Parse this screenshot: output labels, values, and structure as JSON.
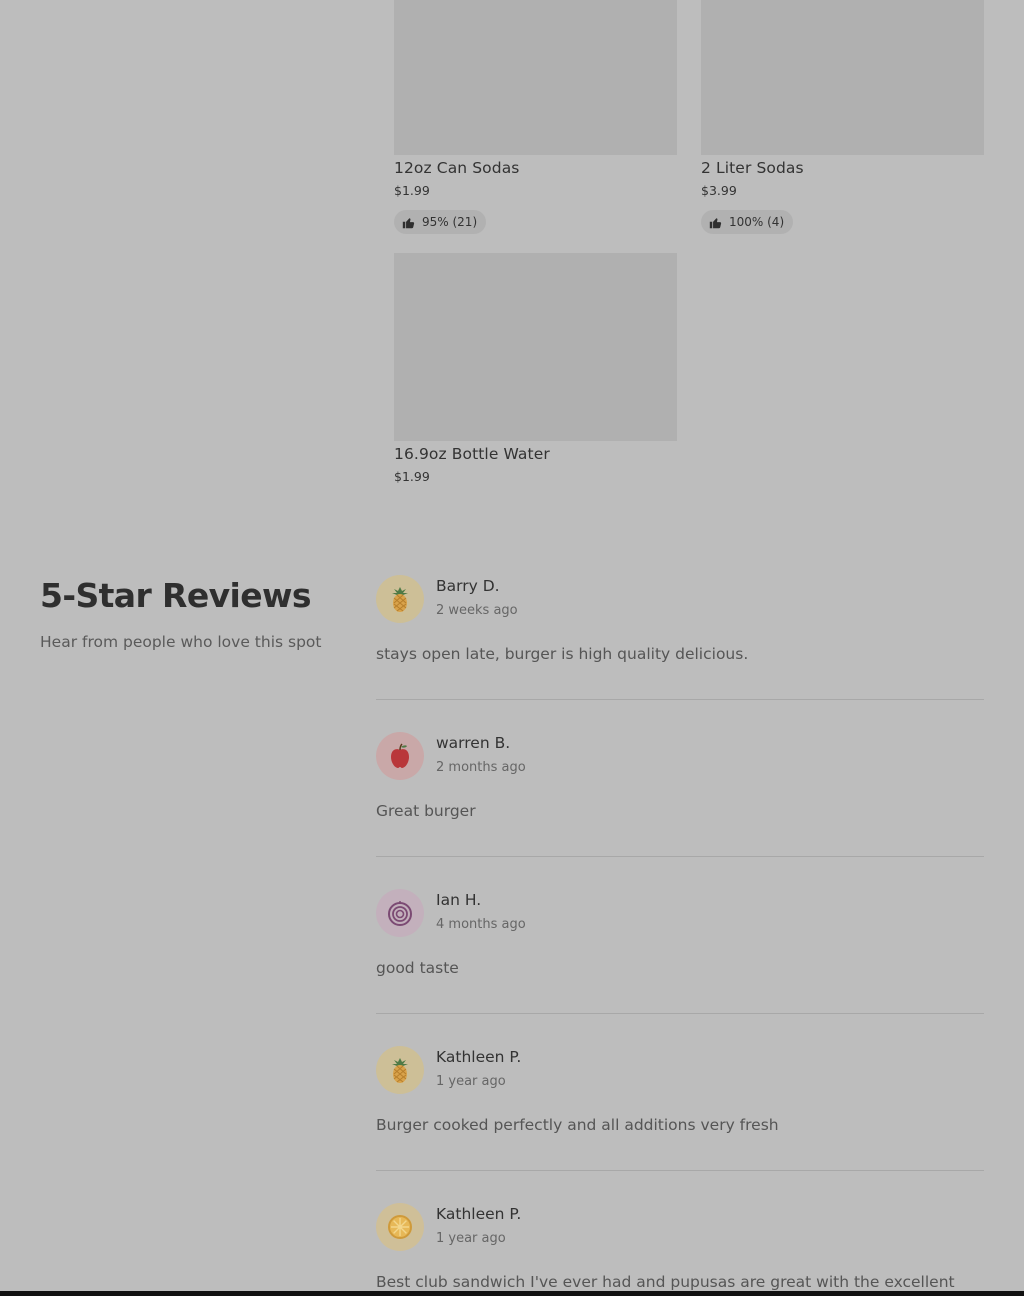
{
  "products": [
    {
      "name": "12oz Can Sodas",
      "price": "$1.99",
      "rating": "95% (21)"
    },
    {
      "name": "2 Liter Sodas",
      "price": "$3.99",
      "rating": "100% (4)"
    },
    {
      "name": "16.9oz Bottle Water",
      "price": "$1.99"
    }
  ],
  "reviews_section": {
    "title": "5-Star Reviews",
    "subtitle": "Hear from people who love this spot"
  },
  "reviews": [
    {
      "author": "Barry D.",
      "date": "2 weeks ago",
      "text": "stays open late, burger is high quality delicious.",
      "avatar_icon": "pineapple-icon",
      "avatar_color": "#cdbf97"
    },
    {
      "author": "warren B.",
      "date": "2 months ago",
      "text": "Great burger",
      "avatar_icon": "apple-icon",
      "avatar_color": "#c9a8a8"
    },
    {
      "author": "Ian H.",
      "date": "4 months ago",
      "text": "good taste",
      "avatar_icon": "onion-icon",
      "avatar_color": "#c3b0bc"
    },
    {
      "author": "Kathleen P.",
      "date": "1 year ago",
      "text": "Burger cooked perfectly and all additions very fresh",
      "avatar_icon": "pineapple-icon",
      "avatar_color": "#cdbf97"
    },
    {
      "author": "Kathleen P.",
      "date": "1 year ago",
      "text": "Best club sandwich I've ever had and pupusas are great with the excellent",
      "avatar_icon": "lemon-icon",
      "avatar_color": "#cfbf98"
    }
  ],
  "colors": {
    "background": "#bdbdbd",
    "thumbnail": "#b0b0b0",
    "rating_pill": "#b1b1b1"
  }
}
